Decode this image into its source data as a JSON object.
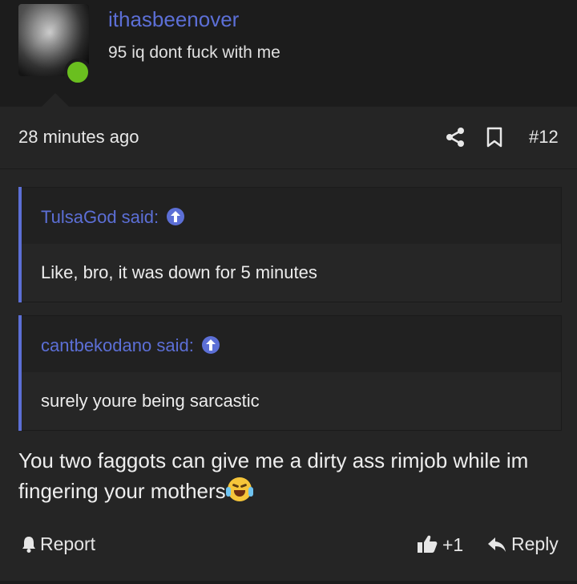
{
  "post": {
    "username": "ithasbeenover",
    "user_title": "95 iq dont fuck with me",
    "timestamp": "28 minutes ago",
    "post_number": "#12",
    "message": "You two faggots can give me a dirty ass rimjob while im fingering your mothers",
    "message_emoji": "face-with-tears-of-joy"
  },
  "quotes": [
    {
      "author": "TulsaGod said:",
      "text": "Like, bro, it was down for 5 minutes"
    },
    {
      "author": "cantbekodano said:",
      "text": "surely youre being sarcastic"
    }
  ],
  "footer": {
    "report_label": "Report",
    "like_count": "+1",
    "reply_label": "Reply"
  },
  "colors": {
    "accent": "#5c6fd6",
    "online": "#6abf1f",
    "background": "#252525"
  },
  "icons": [
    "share-icon",
    "bookmark-icon",
    "bell-icon",
    "thumbs-up-icon",
    "reply-arrow-icon",
    "arrow-up-icon"
  ]
}
